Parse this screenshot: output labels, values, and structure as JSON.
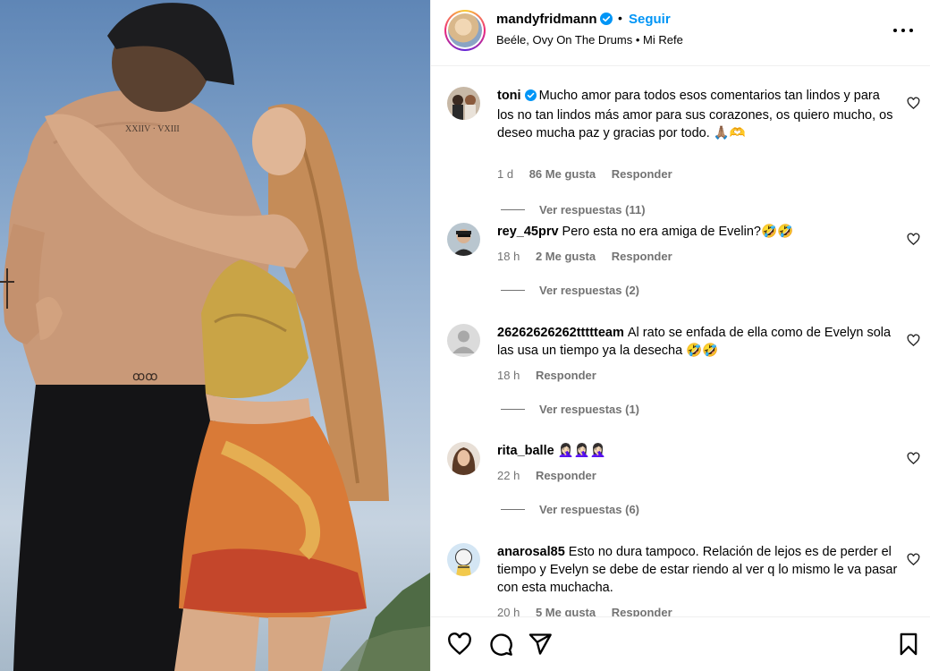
{
  "post": {
    "username": "mandyfridmann",
    "follow_label": "Seguir",
    "audio_artist": "Beéle, Ovy On The Drums",
    "audio_track": "Mi Refe"
  },
  "comments": [
    {
      "username": "toni",
      "verified": true,
      "text": "Mucho amor para todos esos comentarios tan lindos y para los no tan lindos más amor para sus corazones, os quiero mucho, os deseo mucha paz y gracias por todo. 🙏🏽🫶",
      "time": "1 d",
      "likes": "86 Me gusta",
      "reply_label": "Responder",
      "replies_label": "Ver respuestas (11)"
    },
    {
      "username": "rey_45prv",
      "verified": false,
      "text": "Pero esta no era amiga de Evelin?🤣🤣",
      "time": "18 h",
      "likes": "2 Me gusta",
      "reply_label": "Responder",
      "replies_label": "Ver respuestas (2)"
    },
    {
      "username": "26262626262ttttteam",
      "verified": false,
      "text": "Al rato se enfada de ella como de Evelyn sola las usa un tiempo ya la desecha 🤣🤣",
      "time": "18 h",
      "likes": "",
      "reply_label": "Responder",
      "replies_label": "Ver respuestas (1)"
    },
    {
      "username": "rita_balle",
      "verified": false,
      "text": "🤦🏻‍♀️🤦🏻‍♀️🤦🏻‍♀️",
      "time": "22 h",
      "likes": "",
      "reply_label": "Responder",
      "replies_label": "Ver respuestas (6)"
    },
    {
      "username": "anarosal85",
      "verified": false,
      "text": "Esto no dura tampoco. Relación de lejos es de perder el tiempo y Evelyn se debe de estar riendo al ver q lo mismo le va pasar con esta muchacha.",
      "time": "20 h",
      "likes": "5 Me gusta",
      "reply_label": "Responder",
      "replies_label": ""
    }
  ],
  "icons": {
    "like": "heart-icon",
    "comment": "comment-icon",
    "share": "send-icon",
    "save": "bookmark-icon",
    "more": "more-icon",
    "verified": "verified-icon"
  },
  "colors": {
    "accent": "#0095f6",
    "muted": "#737373",
    "verified": "#0095f6"
  }
}
